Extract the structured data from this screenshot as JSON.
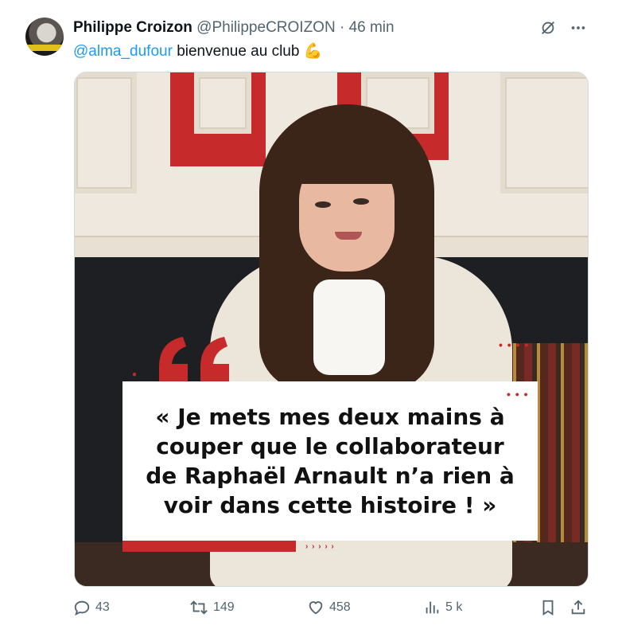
{
  "tweet": {
    "author_name": "Philippe Croizon",
    "handle": "@PhilippeCROIZON",
    "separator": "·",
    "time": "46 min",
    "mention": "@alma_dufour",
    "text": " bienvenue au club 💪"
  },
  "media": {
    "quote_text": "« Je mets mes deux mains à couper que le collaborateur de Raphaël Arnault n’a rien à voir dans cette histoire ! »",
    "accent_color": "#c72a2a",
    "dots_top": "• • •",
    "dots_mid": "• • • •",
    "dots_bottom": "› › › › ›"
  },
  "actions": {
    "replies": "43",
    "reposts": "149",
    "likes": "458",
    "views": "5 k"
  },
  "icons": [
    "grok-icon",
    "more-icon",
    "reply-icon",
    "repost-icon",
    "like-icon",
    "views-icon",
    "bookmark-icon",
    "share-icon"
  ]
}
